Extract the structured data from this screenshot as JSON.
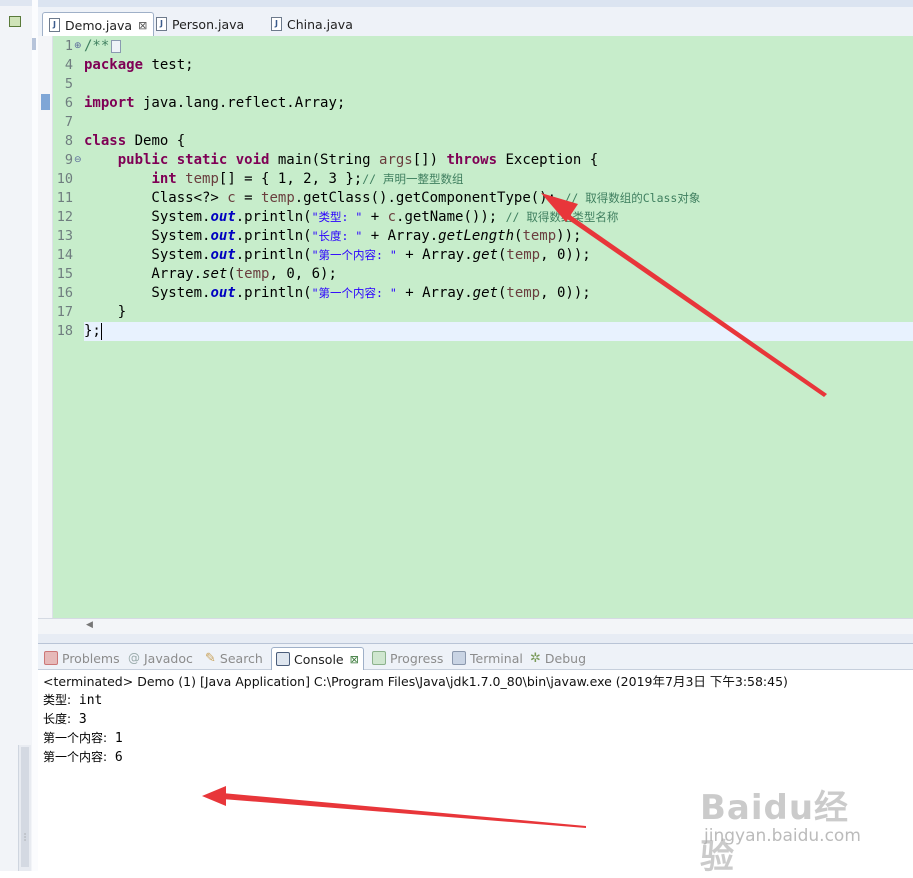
{
  "editor_tabs": [
    {
      "label": "Demo.java",
      "close": "⊠"
    },
    {
      "label": "Person.java"
    },
    {
      "label": "China.java"
    }
  ],
  "editor": {
    "line_numbers": [
      "1",
      "4",
      "5",
      "6",
      "7",
      "8",
      "9",
      "10",
      "11",
      "12",
      "13",
      "14",
      "15",
      "16",
      "17",
      "18"
    ],
    "lines": {
      "l1": "/**",
      "l4_kw": "package",
      "l4_rest": " test;",
      "l6_kw": "import",
      "l6_rest": " java.lang.reflect.Array;",
      "l8_kw": "class",
      "l8_rest": " Demo {",
      "l9_indent": "    ",
      "l9_kw1": "public static void",
      "l9_mid": " main(String ",
      "l9_var": "args",
      "l9_mid2": "[]) ",
      "l9_kw2": "throws",
      "l9_end": " Exception {",
      "l10_indent": "        ",
      "l10_kw": "int",
      "l10_var": " temp",
      "l10_rest": "[] = { 1, 2, 3 };",
      "l10_cm": "// 声明一整型数组",
      "l11_a": "        Class<?> ",
      "l11_var": "c",
      "l11_b": " = ",
      "l11_var2": "temp",
      "l11_c": ".getClass().getComponentType(); ",
      "l11_cm": "// 取得数组的Class对象",
      "l12_a": "        System.",
      "l12_fd": "out",
      "l12_b": ".println(",
      "l12_st": "\"类型: \"",
      "l12_c": " + ",
      "l12_var": "c",
      "l12_d": ".getName()); ",
      "l12_cm": "// 取得数组类型名称",
      "l13_a": "        System.",
      "l13_fd": "out",
      "l13_b": ".println(",
      "l13_st": "\"长度: \"",
      "l13_c": " + Array.",
      "l13_mi": "getLength",
      "l13_d": "(",
      "l13_var": "temp",
      "l13_e": "));",
      "l14_a": "        System.",
      "l14_fd": "out",
      "l14_b": ".println(",
      "l14_st": "\"第一个内容: \"",
      "l14_c": " + Array.",
      "l14_mi": "get",
      "l14_d": "(",
      "l14_var": "temp",
      "l14_e": ", 0));",
      "l15_a": "        Array.",
      "l15_mi": "set",
      "l15_b": "(",
      "l15_var": "temp",
      "l15_c": ", 0, 6);",
      "l16_a": "        System.",
      "l16_fd": "out",
      "l16_b": ".println(",
      "l16_st": "\"第一个内容: \"",
      "l16_c": " + Array.",
      "l16_mi": "get",
      "l16_d": "(",
      "l16_var": "temp",
      "l16_e": ", 0));",
      "l17": "    }",
      "l18": "};"
    }
  },
  "console_tabs": [
    "Problems",
    "Javadoc",
    "Search",
    "Console",
    "Progress",
    "Terminal",
    "Debug"
  ],
  "console": {
    "title": "<terminated> Demo (1) [Java Application] C:\\Program Files\\Java\\jdk1.7.0_80\\bin\\javaw.exe (2019年7月3日 下午3:58:45)",
    "output": [
      {
        "label": "类型:",
        "value": " int"
      },
      {
        "label": "长度:",
        "value": " 3"
      },
      {
        "label": "第一个内容:",
        "value": " 1"
      },
      {
        "label": "第一个内容:",
        "value": " 6"
      }
    ]
  },
  "watermark": {
    "brand": "Baidu经验",
    "url": "jingyan.baidu.com"
  },
  "colors": {
    "editor_bg": "#c7edcb",
    "keyword": "#7f0055",
    "comment": "#3f7f5f",
    "string": "#2a00ff",
    "field": "#0000c0",
    "arrow": "#e8363a"
  }
}
